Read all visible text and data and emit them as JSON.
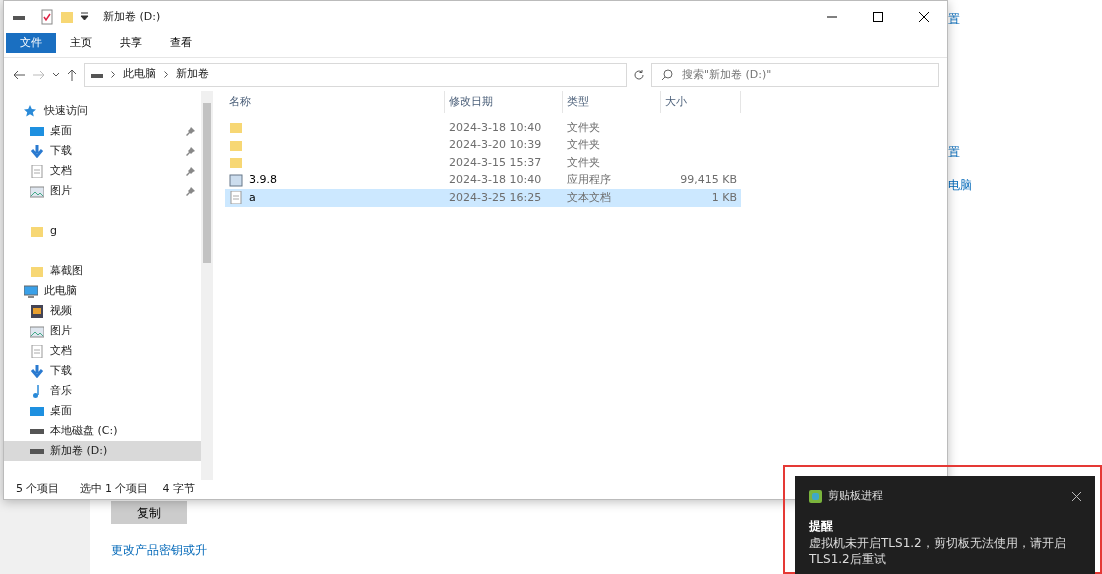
{
  "background": {
    "right_links": [
      "置",
      "置",
      "电脑"
    ],
    "copy_button": "复制",
    "product_key_link": "更改产品密钥或升"
  },
  "window": {
    "title": "新加卷 (D:)",
    "ribbon_tabs": [
      {
        "label": "文件",
        "selected": true
      },
      {
        "label": "主页",
        "selected": false
      },
      {
        "label": "共享",
        "selected": false
      },
      {
        "label": "查看",
        "selected": false
      }
    ],
    "breadcrumb": [
      "此电脑",
      "新加卷"
    ],
    "search": {
      "placeholder": "搜索\"新加卷 (D:)\""
    },
    "nav": [
      {
        "kind": "star",
        "label": "快速访问",
        "selected": false,
        "pinned": false
      },
      {
        "kind": "desktop",
        "label": "桌面",
        "selected": false,
        "pinned": true
      },
      {
        "kind": "download",
        "label": "下载",
        "selected": false,
        "pinned": true
      },
      {
        "kind": "document",
        "label": "文档",
        "selected": false,
        "pinned": true
      },
      {
        "kind": "picture",
        "label": "图片",
        "selected": false,
        "pinned": true
      },
      {
        "kind": "folder",
        "label": "g",
        "selected": false,
        "pinned": false
      },
      {
        "kind": "folder",
        "label": "幕截图",
        "selected": false,
        "pinned": false
      },
      {
        "kind": "computer",
        "label": "此电脑",
        "selected": false,
        "pinned": false
      },
      {
        "kind": "video",
        "label": "视频",
        "selected": false,
        "pinned": false
      },
      {
        "kind": "picture",
        "label": "图片",
        "selected": false,
        "pinned": false
      },
      {
        "kind": "document",
        "label": "文档",
        "selected": false,
        "pinned": false
      },
      {
        "kind": "download",
        "label": "下载",
        "selected": false,
        "pinned": false
      },
      {
        "kind": "music",
        "label": "音乐",
        "selected": false,
        "pinned": false
      },
      {
        "kind": "desktop",
        "label": "桌面",
        "selected": false,
        "pinned": false
      },
      {
        "kind": "drive",
        "label": "本地磁盘 (C:)",
        "selected": false,
        "pinned": false
      },
      {
        "kind": "drive",
        "label": "新加卷 (D:)",
        "selected": true,
        "pinned": false
      }
    ],
    "columns": [
      "名称",
      "修改日期",
      "类型",
      "大小"
    ],
    "rows": [
      {
        "kind": "folder",
        "name": "",
        "date": "2024-3-18 10:40",
        "type": "文件夹",
        "size": "",
        "selected": false
      },
      {
        "kind": "folder",
        "name": "",
        "date": "2024-3-20 10:39",
        "type": "文件夹",
        "size": "",
        "selected": false
      },
      {
        "kind": "folder",
        "name": "",
        "date": "2024-3-15 15:37",
        "type": "文件夹",
        "size": "",
        "selected": false
      },
      {
        "kind": "app",
        "name": "3.9.8",
        "date": "2024-3-18 10:40",
        "type": "应用程序",
        "size": "99,415 KB",
        "selected": false
      },
      {
        "kind": "text",
        "name": "a",
        "date": "2024-3-25 16:25",
        "type": "文本文档",
        "size": "1 KB",
        "selected": true
      }
    ],
    "status": [
      "5 个项目",
      "选中 1 个项目",
      "4 字节"
    ]
  },
  "toast": {
    "app": "剪贴板进程",
    "title": "提醒",
    "body": "虚拟机未开启TLS1.2，剪切板无法使用，请开启TLS1.2后重试"
  }
}
